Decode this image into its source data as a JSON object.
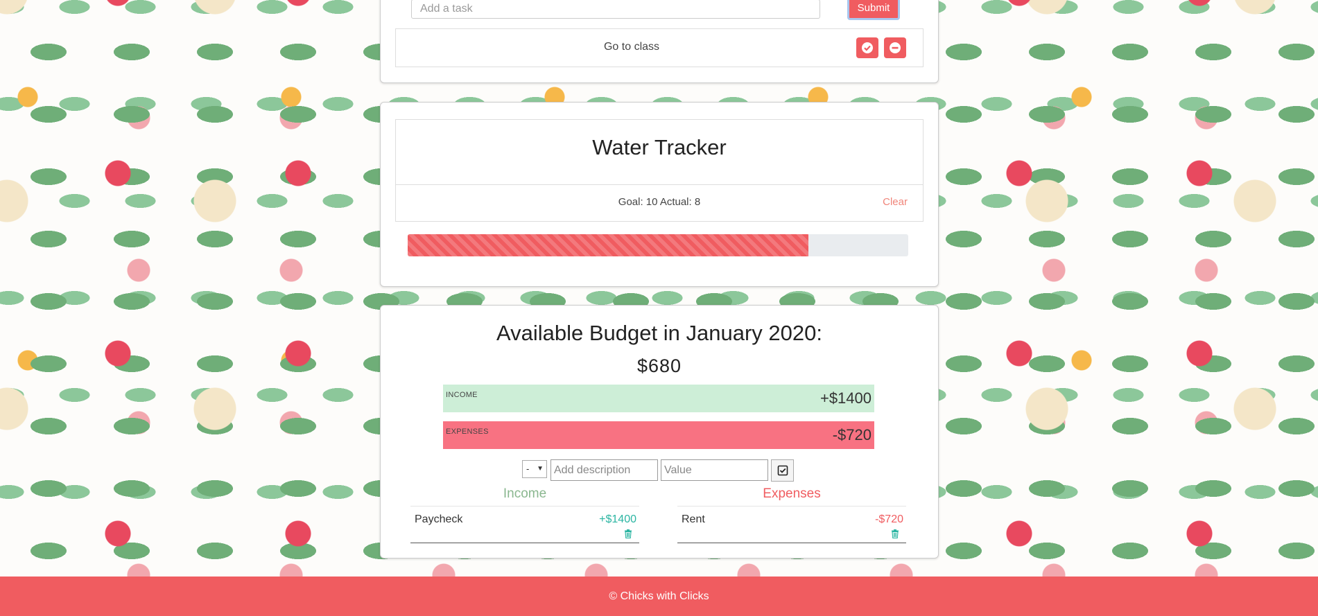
{
  "todo": {
    "input_placeholder": "Add a task",
    "submit_label": "Submit",
    "tasks": [
      {
        "text": "Go to class"
      }
    ]
  },
  "water": {
    "title": "Water Tracker",
    "stats": "Goal: 10 Actual: 8",
    "clear_label": "Clear",
    "goal": 10,
    "actual": 8,
    "progress_fraction": 0.8,
    "bar_color": "#f05c60"
  },
  "budget": {
    "title": "Available Budget in January 2020:",
    "available": "$680",
    "income_label": "INCOME",
    "income_total": "+$1400",
    "expenses_label": "EXPENSES",
    "expenses_total": "-$720",
    "type_selected": "-",
    "description_placeholder": "Add description",
    "value_placeholder": "Value",
    "income_heading": "Income",
    "expenses_heading": "Expenses",
    "income_items": [
      {
        "description": "Paycheck",
        "value": "+$1400"
      }
    ],
    "expense_items": [
      {
        "description": "Rent",
        "value": "-$720"
      }
    ]
  },
  "footer": {
    "text": "© Chicks with Clicks"
  },
  "colors": {
    "accent": "#f05c60",
    "income_bg": "#cdeed7",
    "expenses_bg": "#f87282",
    "income_text": "#2bb5a2"
  }
}
